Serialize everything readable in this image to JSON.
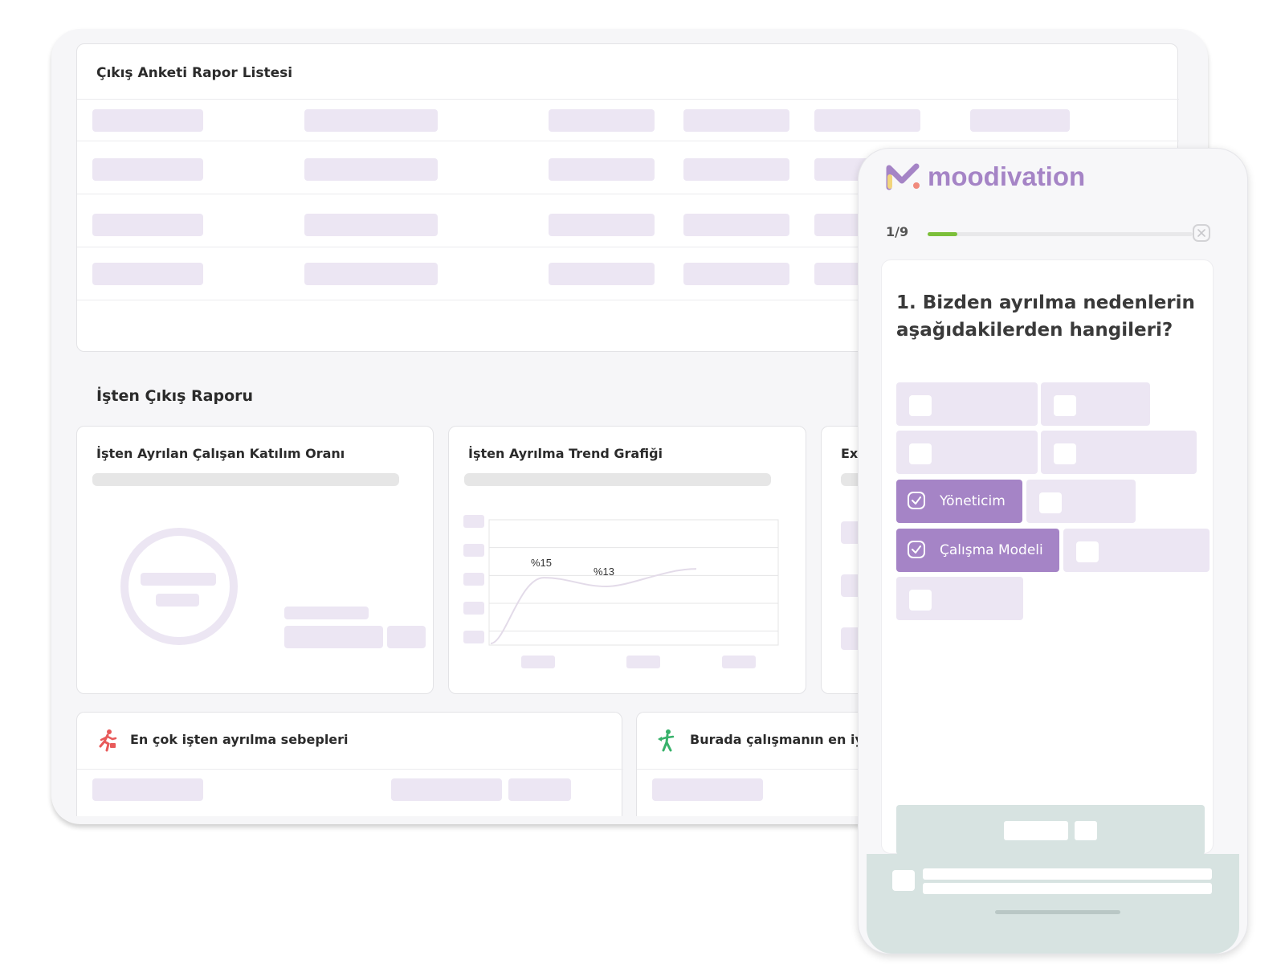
{
  "dashboard": {
    "report_list_title": "Çıkış Anketi Rapor Listesi",
    "exit_report_title": "İşten Çıkış Raporu",
    "participation_card_title": "İşten Ayrılan Çalışan Katılım Oranı",
    "trend_card_title": "İşten Ayrılma Trend Grafiği",
    "third_card_title": "Exi",
    "reasons_card_title": "En çok işten ayrılma sebepleri",
    "best_card_title": "Burada çalışmanın en iyi",
    "icon_reasons": "running-person-icon",
    "icon_best": "walking-person-icon"
  },
  "chart_data": {
    "type": "line",
    "title": "İşten Ayrılma Trend Grafiği",
    "annotations": [
      "%15",
      "%13"
    ],
    "series": [
      {
        "values": [
          0,
          15,
          13,
          17
        ]
      }
    ],
    "grid": true
  },
  "survey": {
    "brand": "moodivation",
    "progress_label": "1/9",
    "progress_value": 0.111,
    "progress_color": "#7cbf3a",
    "question": "1. Bizden ayrılma nedenlerin aşağıdakilerden hangileri?",
    "selected_option_1": "Yöneticim",
    "selected_option_2": "Çalışma Modeli",
    "accent_color": "#a584c6"
  }
}
